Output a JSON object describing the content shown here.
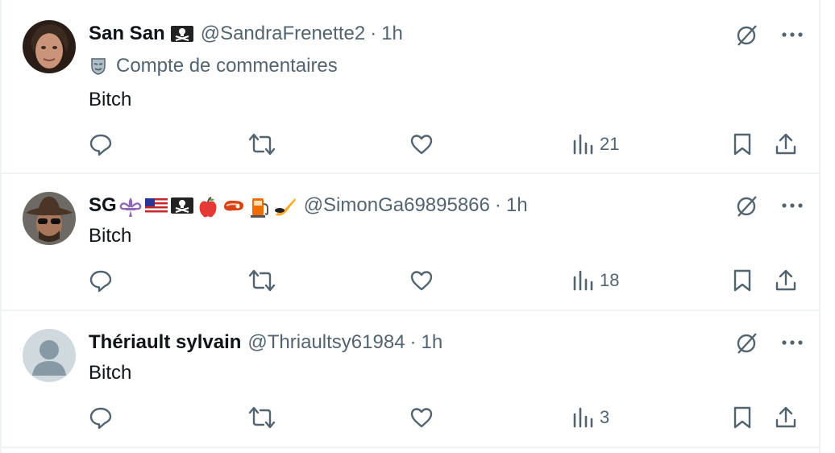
{
  "colors": {
    "text_primary": "#0f1419",
    "text_secondary": "#536471",
    "divider": "#eff3f4"
  },
  "tweets": [
    {
      "name": "San San",
      "badges": [
        "skull-crossbones-flag"
      ],
      "handle": "@SandraFrenette2",
      "separator": "·",
      "time": "1h",
      "community_label": "Compte de commentaires",
      "community_icon": "mask-icon",
      "text": "Bitch",
      "views": "21"
    },
    {
      "name": "SG",
      "badges": [
        "fleur-de-lis",
        "us-flag",
        "skull-crossbones-flag",
        "red-apple",
        "steak",
        "fuel-pump",
        "hockey-stick-puck"
      ],
      "handle": "@SimonGa69895866",
      "separator": "·",
      "time": "1h",
      "text": "Bitch",
      "views": "18"
    },
    {
      "name": "Thériault sylvain",
      "badges": [],
      "handle": "@Thriaultsy61984",
      "separator": "·",
      "time": "1h",
      "text": "Bitch",
      "views": "3"
    }
  ]
}
